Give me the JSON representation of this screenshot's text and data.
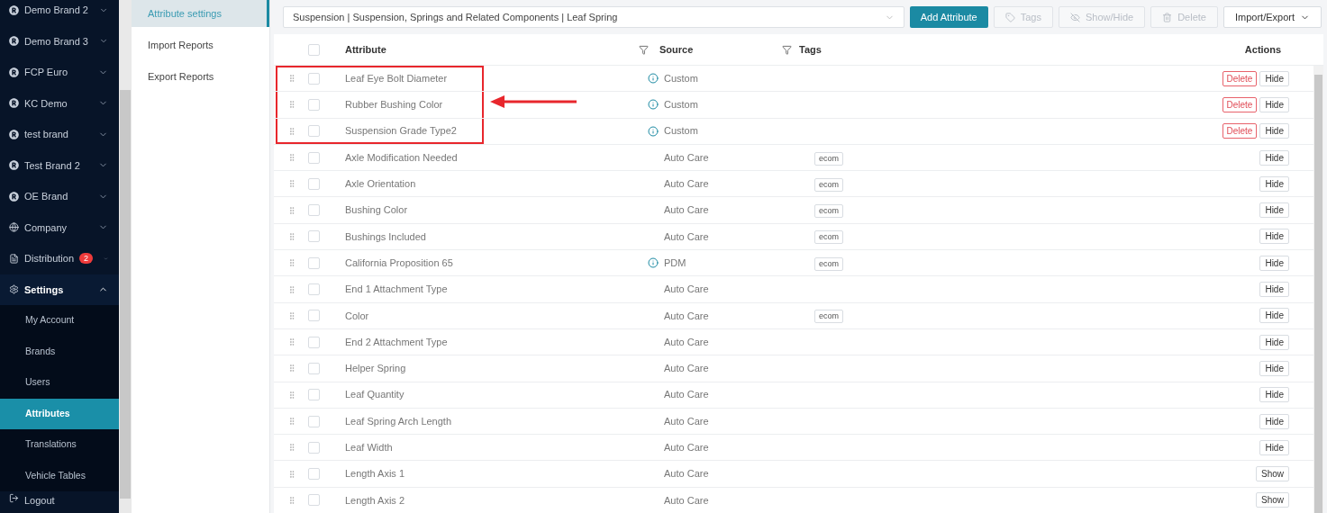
{
  "sidebar": {
    "items": [
      {
        "label": "Demo Brand 2",
        "kind": "brand",
        "expanded": false
      },
      {
        "label": "Demo Brand 3",
        "kind": "brand",
        "expanded": false
      },
      {
        "label": "FCP Euro",
        "kind": "brand",
        "expanded": false
      },
      {
        "label": "KC Demo",
        "kind": "brand",
        "expanded": false
      },
      {
        "label": "test brand",
        "kind": "brand",
        "expanded": false
      },
      {
        "label": "Test Brand 2",
        "kind": "brand",
        "expanded": false
      },
      {
        "label": "OE Brand",
        "kind": "brand",
        "expanded": false
      },
      {
        "label": "Company",
        "kind": "globe",
        "expanded": false
      },
      {
        "label": "Distribution",
        "kind": "doc",
        "expanded": false,
        "badge": "2"
      },
      {
        "label": "Settings",
        "kind": "gear",
        "expanded": true,
        "children": [
          {
            "label": "My Account",
            "selected": false
          },
          {
            "label": "Brands",
            "selected": false
          },
          {
            "label": "Users",
            "selected": false
          },
          {
            "label": "Attributes",
            "selected": true
          },
          {
            "label": "Translations",
            "selected": false
          },
          {
            "label": "Vehicle Tables",
            "selected": false
          }
        ]
      },
      {
        "label": "Logout",
        "kind": "logout"
      }
    ]
  },
  "subnav": {
    "items": [
      {
        "label": "Attribute settings",
        "selected": true
      },
      {
        "label": "Import Reports",
        "selected": false
      },
      {
        "label": "Export Reports",
        "selected": false
      }
    ]
  },
  "toolbar": {
    "category_select": "Suspension | Suspension, Springs and Related Components | Leaf Spring",
    "buttons": [
      {
        "label": "Add Attribute",
        "kind": "primary",
        "disabled": false
      },
      {
        "label": "Tags",
        "kind": "tag",
        "disabled": true
      },
      {
        "label": "Show/Hide",
        "kind": "eye",
        "disabled": true
      },
      {
        "label": "Delete",
        "kind": "trash",
        "disabled": true
      },
      {
        "label": "Import/Export",
        "kind": "menu",
        "disabled": false
      }
    ]
  },
  "table": {
    "columns": [
      "Attribute",
      "Source",
      "Tags",
      "Actions"
    ],
    "all_checked": false,
    "rows": [
      {
        "attribute": "Leaf Eye Bolt Diameter",
        "info": true,
        "source": "Custom",
        "delete": "Delete",
        "toggle": "Hide",
        "checked": false,
        "highlighted": true
      },
      {
        "attribute": "Rubber Bushing Color",
        "info": true,
        "source": "Custom",
        "delete": "Delete",
        "toggle": "Hide",
        "checked": false,
        "highlighted": true
      },
      {
        "attribute": "Suspension Grade Type2",
        "info": true,
        "source": "Custom",
        "delete": "Delete",
        "toggle": "Hide",
        "checked": false,
        "highlighted": true
      },
      {
        "attribute": "Axle Modification Needed",
        "info": false,
        "source": "Auto Care",
        "tag": "ecom",
        "toggle": "Hide",
        "checked": false,
        "highlighted": false
      },
      {
        "attribute": "Axle Orientation",
        "info": false,
        "source": "Auto Care",
        "tag": "ecom",
        "toggle": "Hide",
        "checked": false,
        "highlighted": false
      },
      {
        "attribute": "Bushing Color",
        "info": false,
        "source": "Auto Care",
        "tag": "ecom",
        "toggle": "Hide",
        "checked": false,
        "highlighted": false
      },
      {
        "attribute": "Bushings Included",
        "info": false,
        "source": "Auto Care",
        "tag": "ecom",
        "toggle": "Hide",
        "checked": false,
        "highlighted": false
      },
      {
        "attribute": "California Proposition 65",
        "info": true,
        "source": "PDM",
        "tag": "ecom",
        "toggle": "Hide",
        "checked": false,
        "highlighted": false
      },
      {
        "attribute": "End 1 Attachment Type",
        "info": false,
        "source": "Auto Care",
        "toggle": "Hide",
        "checked": false,
        "highlighted": false
      },
      {
        "attribute": "Color",
        "info": false,
        "source": "Auto Care",
        "tag": "ecom",
        "toggle": "Hide",
        "checked": false,
        "highlighted": false
      },
      {
        "attribute": "End 2 Attachment Type",
        "info": false,
        "source": "Auto Care",
        "toggle": "Hide",
        "checked": false,
        "highlighted": false
      },
      {
        "attribute": "Helper Spring",
        "info": false,
        "source": "Auto Care",
        "toggle": "Hide",
        "checked": false,
        "highlighted": false
      },
      {
        "attribute": "Leaf Quantity",
        "info": false,
        "source": "Auto Care",
        "toggle": "Hide",
        "checked": false,
        "highlighted": false
      },
      {
        "attribute": "Leaf Spring Arch Length",
        "info": false,
        "source": "Auto Care",
        "toggle": "Hide",
        "checked": false,
        "highlighted": false
      },
      {
        "attribute": "Leaf Width",
        "info": false,
        "source": "Auto Care",
        "toggle": "Hide",
        "checked": false,
        "highlighted": false
      },
      {
        "attribute": "Length Axis 1",
        "info": false,
        "source": "Auto Care",
        "toggle": "Show",
        "checked": false,
        "highlighted": false
      },
      {
        "attribute": "Length Axis 2",
        "info": false,
        "source": "Auto Care",
        "toggle": "Show",
        "checked": false,
        "highlighted": false
      }
    ]
  }
}
